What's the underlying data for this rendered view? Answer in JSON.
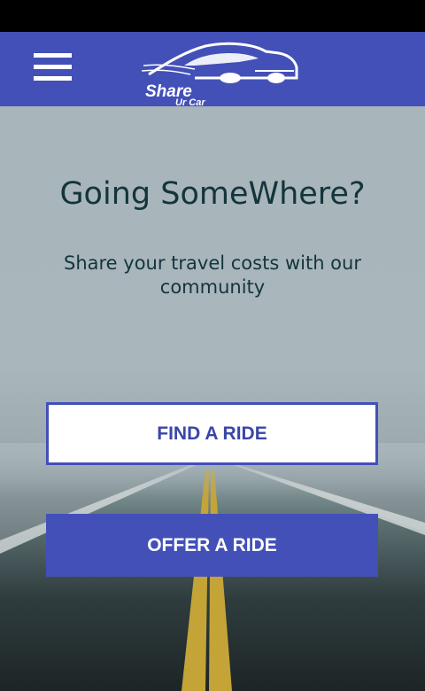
{
  "app": {
    "brand_name": "Share",
    "brand_sub": "Ur Car"
  },
  "header": {
    "menu_icon": "hamburger-menu-icon",
    "logo_icon": "car-logo-icon",
    "color": "#4350b8"
  },
  "hero": {
    "headline": "Going SomeWhere?",
    "tagline": "Share your travel costs with our community"
  },
  "actions": {
    "find_label": "FIND A RIDE",
    "offer_label": "OFFER A RIDE"
  }
}
